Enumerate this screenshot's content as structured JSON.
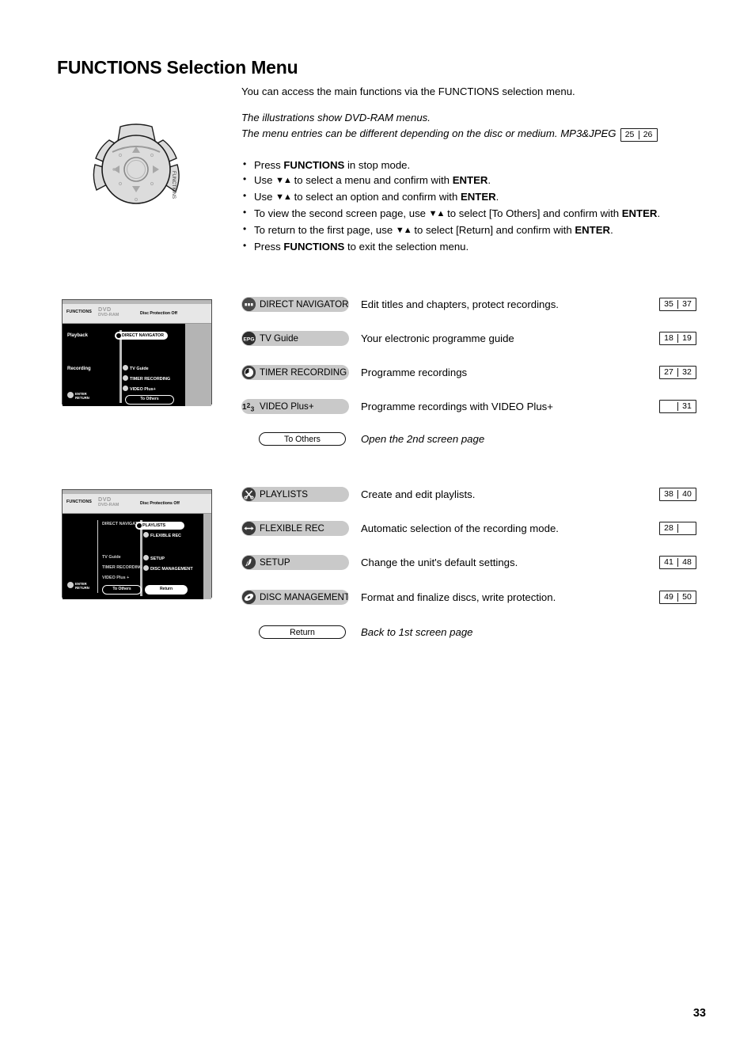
{
  "page": {
    "title_bold": "FUNCTIONS",
    "title_rest": " Selection Menu",
    "folio": "33"
  },
  "intro": {
    "lead": "You can access the main functions via the FUNCTIONS selection menu.",
    "italic_line1": "The illustrations show DVD-RAM menus.",
    "italic_line2": "The menu entries can be different depending on the disc or medium. MP3&JPEG",
    "mp3_ref": {
      "left": "25",
      "right": "26"
    }
  },
  "bullets": [
    {
      "pre": "Press ",
      "bold1": "FUNCTIONS",
      "mid": " in stop mode.",
      "arrows": false
    },
    {
      "pre": "Use ",
      "arrows": true,
      "mid": " to select a menu and confirm with ",
      "bold2": "ENTER",
      "post": "."
    },
    {
      "pre": "Use ",
      "arrows": true,
      "mid": " to select an option and confirm with ",
      "bold2": "ENTER",
      "post": "."
    },
    {
      "pre": "To view the second screen page, use ",
      "arrows": true,
      "mid": " to select [To Others] and confirm with ",
      "bold2": "ENTER",
      "post": "."
    },
    {
      "pre": "To return to the first page, use ",
      "arrows": true,
      "mid": " to select [Return] and confirm with ",
      "bold2": "ENTER",
      "post": "."
    },
    {
      "pre": "Press ",
      "bold1": "FUNCTIONS",
      "mid": " to exit the selection menu.",
      "arrows": false
    }
  ],
  "remote": {
    "functions_label": "FUNCTIONS"
  },
  "screen_one": {
    "header": {
      "functions": "FUNCTIONS",
      "disc_logo_top": "DVD",
      "disc_logo_sub": "DVD-RAM",
      "protection": "Disc Protection  Off"
    },
    "col_playback": "Playback",
    "col_recording": "Recording",
    "selected_item": "DIRECT NAVIGATOR",
    "items": [
      "TV Guide",
      "TIMER RECORDING",
      "VIDEO Plus+"
    ],
    "to_others": "To Others",
    "enter": "ENTER",
    "return": "RETURN"
  },
  "screen_two": {
    "header": {
      "functions": "FUNCTIONS",
      "disc_logo_top": "DVD",
      "disc_logo_sub": "DVD-RAM",
      "protection": "Disc Protections  Off"
    },
    "left_items": [
      "DIRECT NAVIGATOR",
      "TV Guide",
      "TIMER RECORDING",
      "VIDEO Plus +"
    ],
    "selected_item": "PLAYLISTS",
    "right_items": [
      "FLEXIBLE REC",
      "SETUP",
      "DISC MANAGEMENT"
    ],
    "to_others": "To Others",
    "return_btn": "Return",
    "enter": "ENTER",
    "return": "RETURN"
  },
  "menu_group_1": [
    {
      "icon": "direct-navigator-icon",
      "label": "DIRECT NAVIGATOR",
      "description": "Edit titles and chapters, protect recordings.",
      "ref": {
        "left": "35",
        "right": "37"
      }
    },
    {
      "icon": "epg-icon",
      "label": "TV Guide",
      "description": "Your electronic programme guide",
      "ref": {
        "left": "18",
        "right": "19"
      }
    },
    {
      "icon": "clock-icon",
      "label": "TIMER RECORDING",
      "description": "Programme recordings",
      "ref": {
        "left": "27",
        "right": "32"
      }
    },
    {
      "icon": "numbers-icon",
      "label": "VIDEO Plus+",
      "description": "Programme recordings with VIDEO Plus+",
      "ref": {
        "left": "",
        "right": "31"
      }
    }
  ],
  "group_1_footer": {
    "button": "To Others",
    "description": "Open the 2nd screen page"
  },
  "menu_group_2": [
    {
      "icon": "scissors-icon",
      "label": "PLAYLISTS",
      "description": "Create and edit playlists.",
      "ref": {
        "left": "38",
        "right": "40"
      }
    },
    {
      "icon": "double-arrow-icon",
      "label": "FLEXIBLE REC",
      "description": "Automatic selection of the recording mode.",
      "ref": {
        "left": "28",
        "right": ""
      }
    },
    {
      "icon": "wrench-icon",
      "label": "SETUP",
      "description": "Change the unit's default settings.",
      "ref": {
        "left": "41",
        "right": "48"
      }
    },
    {
      "icon": "disc-icon",
      "label": "DISC MANAGEMENT",
      "description": "Format and finalize discs, write protection.",
      "ref": {
        "left": "49",
        "right": "50"
      }
    }
  ],
  "group_2_footer": {
    "button": "Return",
    "description": "Back to 1st screen page"
  }
}
